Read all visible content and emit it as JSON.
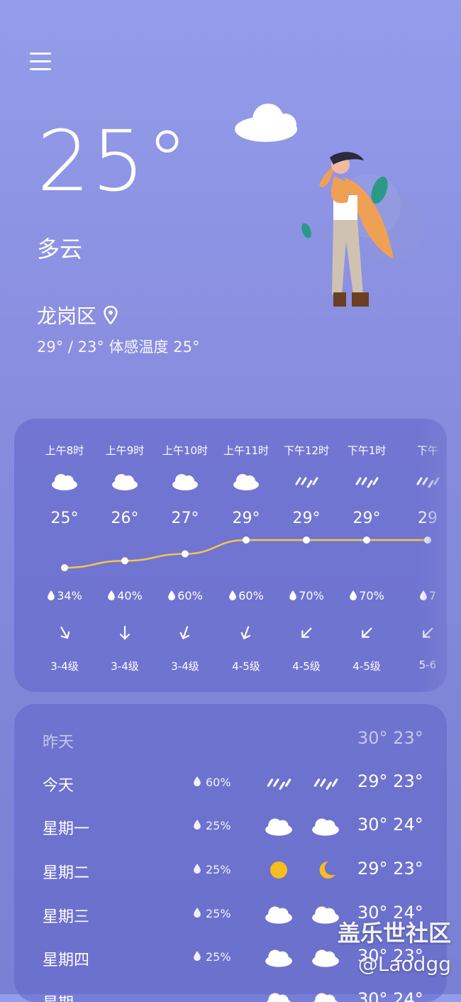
{
  "current": {
    "temperature": "25°",
    "condition": "多云",
    "location": "龙岗区",
    "range_feels": "29° / 23° 体感温度 25°"
  },
  "hourly": [
    {
      "time": "上午8时",
      "icon": "cloud",
      "temp": "25°",
      "precip": "34%",
      "wind": "3-4级"
    },
    {
      "time": "上午9时",
      "icon": "cloud",
      "temp": "26°",
      "precip": "40%",
      "wind": "3-4级"
    },
    {
      "time": "上午10时",
      "icon": "cloud",
      "temp": "27°",
      "precip": "60%",
      "wind": "3-4级"
    },
    {
      "time": "上午11时",
      "icon": "cloud",
      "temp": "29°",
      "precip": "60%",
      "wind": "4-5级"
    },
    {
      "time": "下午12时",
      "icon": "rain",
      "temp": "29°",
      "precip": "70%",
      "wind": "4-5级"
    },
    {
      "time": "下午1时",
      "icon": "rain",
      "temp": "29°",
      "precip": "70%",
      "wind": "4-5级"
    },
    {
      "time": "下午",
      "icon": "rain",
      "temp": "29",
      "precip": "7",
      "wind": "5-6"
    }
  ],
  "daily": [
    {
      "day": "昨天",
      "precip": "",
      "day_icon": "",
      "night_icon": "",
      "temps": "30° 23°"
    },
    {
      "day": "今天",
      "precip": "60%",
      "day_icon": "rain",
      "night_icon": "rain",
      "temps": "29° 23°"
    },
    {
      "day": "星期一",
      "precip": "25%",
      "day_icon": "cloud",
      "night_icon": "cloud",
      "temps": "30° 24°"
    },
    {
      "day": "星期二",
      "precip": "25%",
      "day_icon": "sun",
      "night_icon": "moon",
      "temps": "29° 23°"
    },
    {
      "day": "星期三",
      "precip": "25%",
      "day_icon": "cloud",
      "night_icon": "cloud",
      "temps": "30° 24°"
    },
    {
      "day": "星期四",
      "precip": "25%",
      "day_icon": "cloud",
      "night_icon": "cloud",
      "temps": "30° 23°"
    },
    {
      "day": "星期",
      "precip": "",
      "day_icon": "cloud",
      "night_icon": "cloud",
      "temps": "30° 24°"
    }
  ],
  "watermark": {
    "title": "盖乐世社区",
    "handle": "@Laodgg"
  },
  "colors": {
    "accent_line": "#f5c64a",
    "sun": "#f7bd1e",
    "text": "#ffffff"
  }
}
